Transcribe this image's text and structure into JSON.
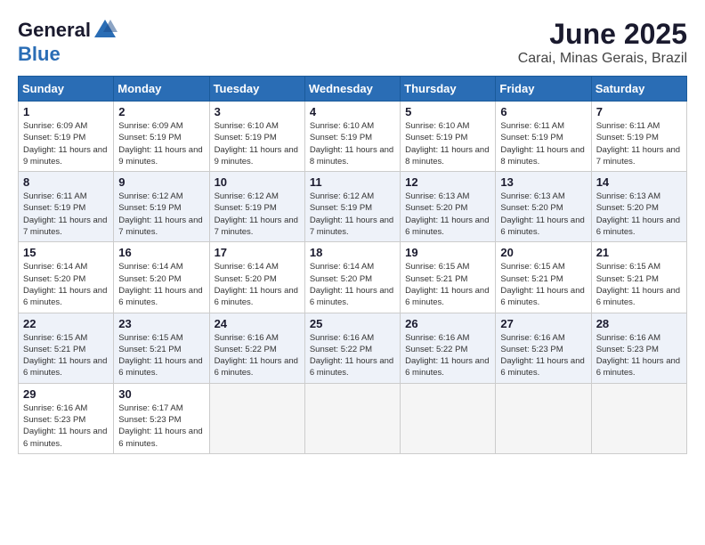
{
  "header": {
    "logo_general": "General",
    "logo_blue": "Blue",
    "month_year": "June 2025",
    "location": "Carai, Minas Gerais, Brazil"
  },
  "calendar": {
    "days_of_week": [
      "Sunday",
      "Monday",
      "Tuesday",
      "Wednesday",
      "Thursday",
      "Friday",
      "Saturday"
    ],
    "weeks": [
      [
        {
          "day": "1",
          "info": "Sunrise: 6:09 AM\nSunset: 5:19 PM\nDaylight: 11 hours and 9 minutes."
        },
        {
          "day": "2",
          "info": "Sunrise: 6:09 AM\nSunset: 5:19 PM\nDaylight: 11 hours and 9 minutes."
        },
        {
          "day": "3",
          "info": "Sunrise: 6:10 AM\nSunset: 5:19 PM\nDaylight: 11 hours and 9 minutes."
        },
        {
          "day": "4",
          "info": "Sunrise: 6:10 AM\nSunset: 5:19 PM\nDaylight: 11 hours and 8 minutes."
        },
        {
          "day": "5",
          "info": "Sunrise: 6:10 AM\nSunset: 5:19 PM\nDaylight: 11 hours and 8 minutes."
        },
        {
          "day": "6",
          "info": "Sunrise: 6:11 AM\nSunset: 5:19 PM\nDaylight: 11 hours and 8 minutes."
        },
        {
          "day": "7",
          "info": "Sunrise: 6:11 AM\nSunset: 5:19 PM\nDaylight: 11 hours and 7 minutes."
        }
      ],
      [
        {
          "day": "8",
          "info": "Sunrise: 6:11 AM\nSunset: 5:19 PM\nDaylight: 11 hours and 7 minutes."
        },
        {
          "day": "9",
          "info": "Sunrise: 6:12 AM\nSunset: 5:19 PM\nDaylight: 11 hours and 7 minutes."
        },
        {
          "day": "10",
          "info": "Sunrise: 6:12 AM\nSunset: 5:19 PM\nDaylight: 11 hours and 7 minutes."
        },
        {
          "day": "11",
          "info": "Sunrise: 6:12 AM\nSunset: 5:19 PM\nDaylight: 11 hours and 7 minutes."
        },
        {
          "day": "12",
          "info": "Sunrise: 6:13 AM\nSunset: 5:20 PM\nDaylight: 11 hours and 6 minutes."
        },
        {
          "day": "13",
          "info": "Sunrise: 6:13 AM\nSunset: 5:20 PM\nDaylight: 11 hours and 6 minutes."
        },
        {
          "day": "14",
          "info": "Sunrise: 6:13 AM\nSunset: 5:20 PM\nDaylight: 11 hours and 6 minutes."
        }
      ],
      [
        {
          "day": "15",
          "info": "Sunrise: 6:14 AM\nSunset: 5:20 PM\nDaylight: 11 hours and 6 minutes."
        },
        {
          "day": "16",
          "info": "Sunrise: 6:14 AM\nSunset: 5:20 PM\nDaylight: 11 hours and 6 minutes."
        },
        {
          "day": "17",
          "info": "Sunrise: 6:14 AM\nSunset: 5:20 PM\nDaylight: 11 hours and 6 minutes."
        },
        {
          "day": "18",
          "info": "Sunrise: 6:14 AM\nSunset: 5:20 PM\nDaylight: 11 hours and 6 minutes."
        },
        {
          "day": "19",
          "info": "Sunrise: 6:15 AM\nSunset: 5:21 PM\nDaylight: 11 hours and 6 minutes."
        },
        {
          "day": "20",
          "info": "Sunrise: 6:15 AM\nSunset: 5:21 PM\nDaylight: 11 hours and 6 minutes."
        },
        {
          "day": "21",
          "info": "Sunrise: 6:15 AM\nSunset: 5:21 PM\nDaylight: 11 hours and 6 minutes."
        }
      ],
      [
        {
          "day": "22",
          "info": "Sunrise: 6:15 AM\nSunset: 5:21 PM\nDaylight: 11 hours and 6 minutes."
        },
        {
          "day": "23",
          "info": "Sunrise: 6:15 AM\nSunset: 5:21 PM\nDaylight: 11 hours and 6 minutes."
        },
        {
          "day": "24",
          "info": "Sunrise: 6:16 AM\nSunset: 5:22 PM\nDaylight: 11 hours and 6 minutes."
        },
        {
          "day": "25",
          "info": "Sunrise: 6:16 AM\nSunset: 5:22 PM\nDaylight: 11 hours and 6 minutes."
        },
        {
          "day": "26",
          "info": "Sunrise: 6:16 AM\nSunset: 5:22 PM\nDaylight: 11 hours and 6 minutes."
        },
        {
          "day": "27",
          "info": "Sunrise: 6:16 AM\nSunset: 5:23 PM\nDaylight: 11 hours and 6 minutes."
        },
        {
          "day": "28",
          "info": "Sunrise: 6:16 AM\nSunset: 5:23 PM\nDaylight: 11 hours and 6 minutes."
        }
      ],
      [
        {
          "day": "29",
          "info": "Sunrise: 6:16 AM\nSunset: 5:23 PM\nDaylight: 11 hours and 6 minutes."
        },
        {
          "day": "30",
          "info": "Sunrise: 6:17 AM\nSunset: 5:23 PM\nDaylight: 11 hours and 6 minutes."
        },
        {
          "day": "",
          "info": ""
        },
        {
          "day": "",
          "info": ""
        },
        {
          "day": "",
          "info": ""
        },
        {
          "day": "",
          "info": ""
        },
        {
          "day": "",
          "info": ""
        }
      ]
    ]
  }
}
